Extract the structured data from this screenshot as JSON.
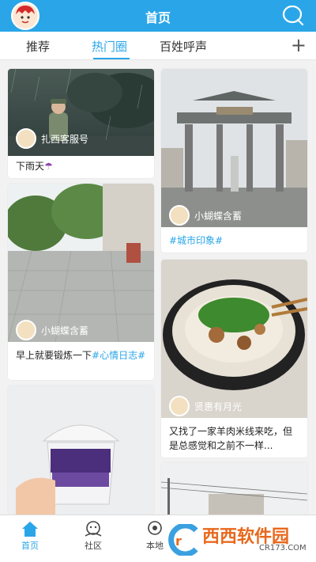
{
  "header": {
    "title": "首页",
    "avatar_icon": "user-avatar-icon",
    "search_icon": "search-icon",
    "color": "#2aa6e8"
  },
  "tabs": [
    {
      "label": "推荐"
    },
    {
      "label": "热门圈"
    },
    {
      "label": "百姓呼声"
    }
  ],
  "active_tab": "热门圈",
  "add_label": "+",
  "feed": [
    {
      "author": "扎西客服号",
      "caption": "下雨天",
      "caption_emoji": "☂"
    },
    {
      "author": "小蝴蝶含蓄",
      "tag": "#城市印象#"
    },
    {
      "author": "小蝴蝶含蓄",
      "caption": "早上就要锻炼一下",
      "tag": "#心情日志#"
    },
    {
      "author": "贤惠有月光",
      "caption": "又找了一家羊肉米线来吃，但是总感觉和之前不一样..."
    }
  ],
  "bottom_nav": [
    {
      "label": "首页",
      "icon": "home-icon"
    },
    {
      "label": "社区",
      "icon": "community-icon"
    },
    {
      "label": "本地",
      "icon": "local-icon"
    }
  ],
  "watermark": {
    "main": "西西软件园",
    "sub": "CR173.COM"
  }
}
